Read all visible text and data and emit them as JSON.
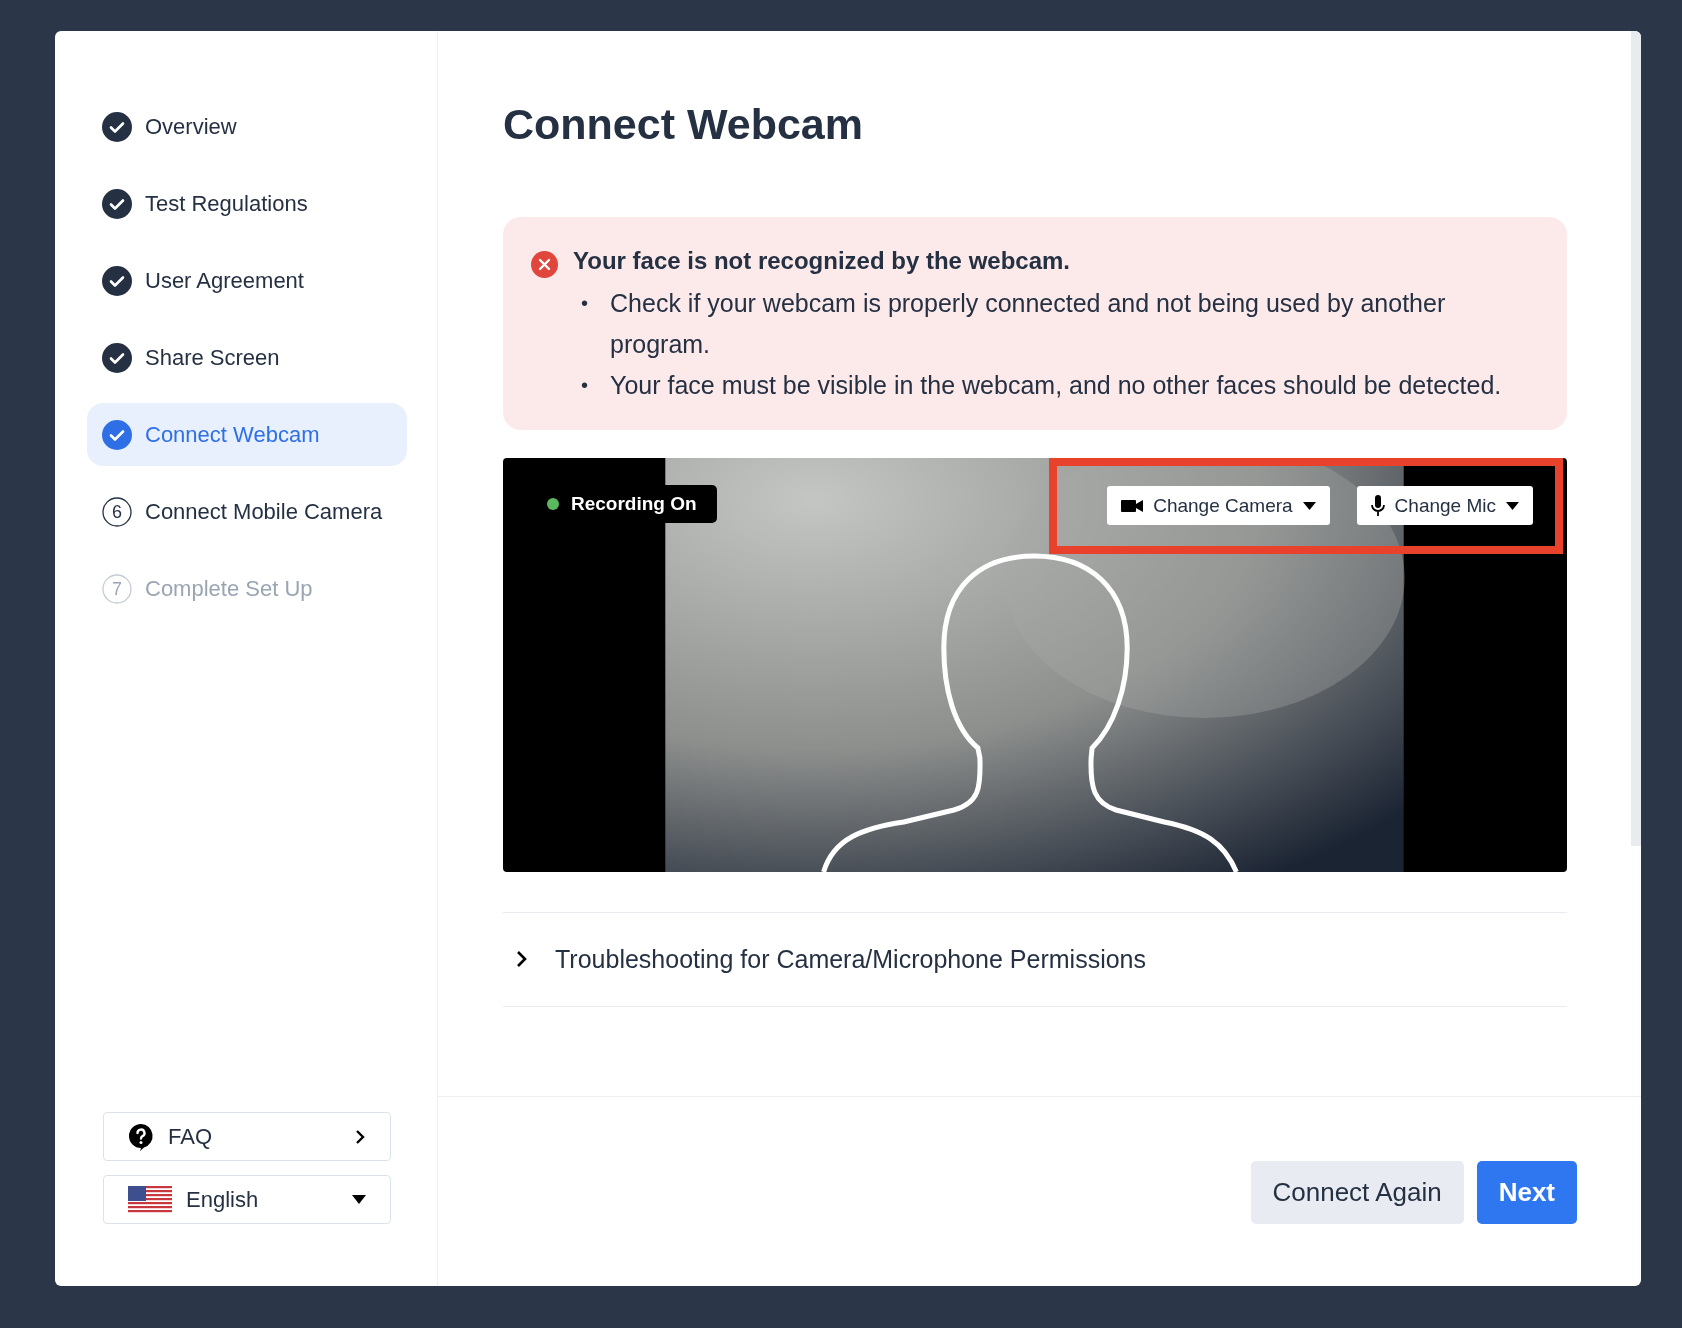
{
  "steps": [
    {
      "label": "Overview",
      "checked": true,
      "disabled": false,
      "selected": false
    },
    {
      "label": "Test Regulations",
      "checked": true,
      "disabled": false,
      "selected": false
    },
    {
      "label": "User Agreement",
      "checked": true,
      "disabled": false,
      "selected": false
    },
    {
      "label": "Share Screen",
      "checked": true,
      "disabled": false,
      "selected": false
    },
    {
      "label": "Connect Webcam",
      "checked": true,
      "disabled": false,
      "selected": true
    },
    {
      "label": "Connect Mobile Camera",
      "checked": false,
      "number": "6",
      "disabled": false,
      "selected": false
    },
    {
      "label": "Complete Set Up",
      "checked": false,
      "number": "7",
      "disabled": true,
      "selected": false
    }
  ],
  "faq": {
    "label": "FAQ"
  },
  "language": {
    "label": "English"
  },
  "title": "Connect Webcam",
  "alert": {
    "heading": "Your face is not recognized by the webcam.",
    "items": [
      {
        "bullet": "•",
        "text": "Check if your webcam is properly connected and not being used by another program."
      },
      {
        "bullet": "•",
        "text": "Your face must be visible in the webcam, and no other faces should be detected."
      }
    ]
  },
  "video": {
    "recording": {
      "label": "Recording On",
      "on": true
    },
    "camera_button": "Change Camera",
    "mic_button": "Change Mic",
    "highlighted": true
  },
  "accordion": [
    {
      "label": "Troubleshooting for Camera/Microphone Permissions",
      "expanded": false
    }
  ],
  "footer": {
    "secondary": "Connect Again",
    "primary": "Next"
  }
}
